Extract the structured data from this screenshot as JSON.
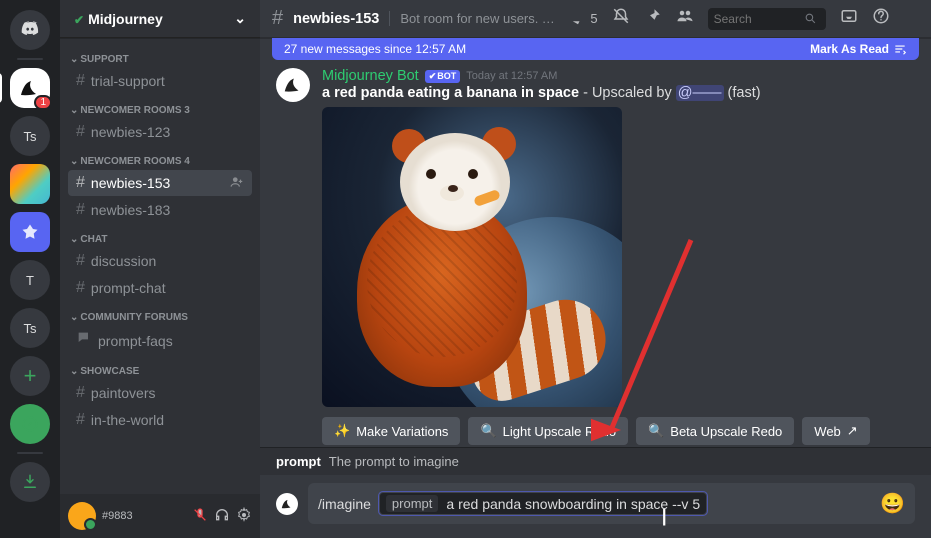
{
  "server_name": "Midjourney",
  "server_badge": "1",
  "ts_label": "Ts",
  "t_label": "T",
  "categories": {
    "support": "SUPPORT",
    "newcomer3": "NEWCOMER ROOMS 3",
    "newcomer4": "NEWCOMER ROOMS 4",
    "chat": "CHAT",
    "forums": "COMMUNITY FORUMS",
    "showcase": "SHOWCASE"
  },
  "channels": {
    "trial_support": "trial-support",
    "nb123": "newbies-123",
    "nb153": "newbies-153",
    "nb183": "newbies-183",
    "discussion": "discussion",
    "prompt_chat": "prompt-chat",
    "prompt_faqs": "prompt-faqs",
    "paintovers": "paintovers",
    "in_the_world": "in-the-world"
  },
  "user_tag": "#9883",
  "top": {
    "channel": "newbies-153",
    "desc": "Bot room for new users. Typ...",
    "thread_count": "5",
    "search_placeholder": "Search"
  },
  "new_msg_bar": {
    "text": "27 new messages since 12:57 AM",
    "mark": "Mark As Read"
  },
  "message": {
    "author": "Midjourney Bot",
    "bot_tag": "BOT",
    "time": "Today at 12:57 AM",
    "prompt_text": "a red panda eating a banana in space",
    "upscaled": " - Upscaled by ",
    "mention": "@——",
    "mode": " (fast)"
  },
  "buttons": {
    "variations": "Make Variations",
    "light": "Light Upscale Redo",
    "beta": "Beta Upscale Redo",
    "web": "Web"
  },
  "hint": {
    "name": "prompt",
    "desc": "The prompt to imagine"
  },
  "input": {
    "command": "/imagine",
    "param_name": "prompt",
    "param_value": "a red panda snowboarding in space --v 5"
  }
}
